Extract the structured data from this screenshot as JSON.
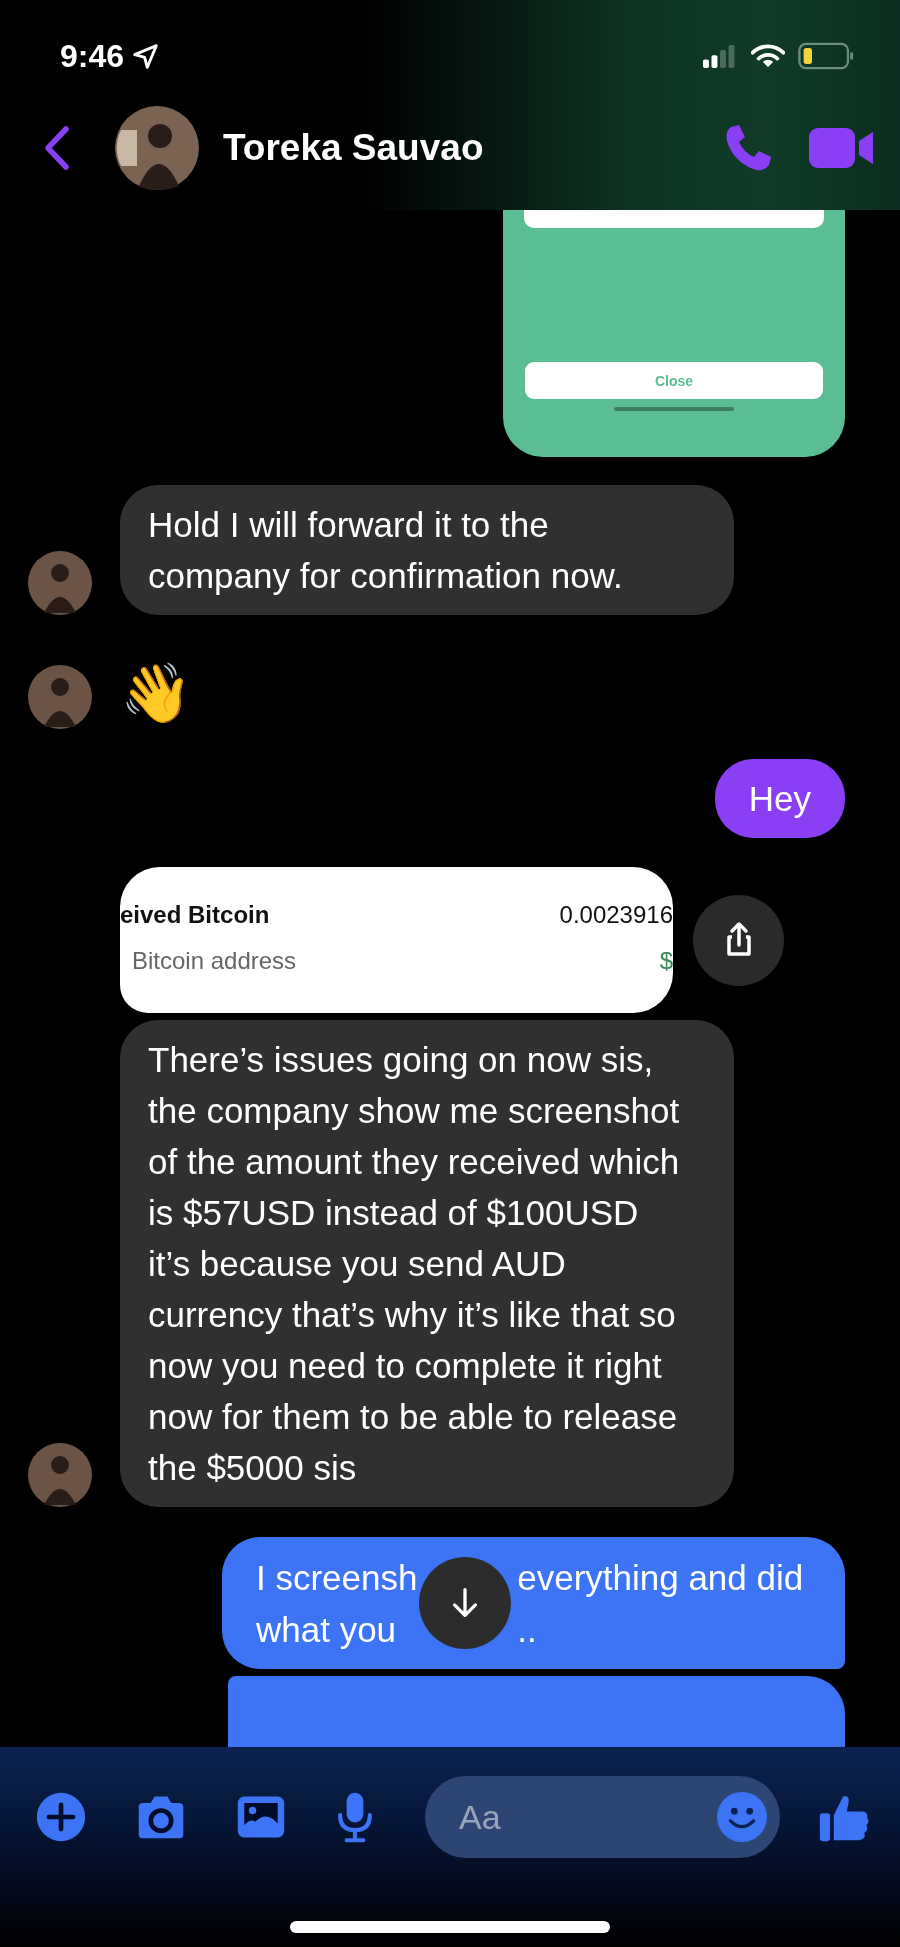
{
  "status_bar": {
    "time": "9:46"
  },
  "header": {
    "contact_name": "Toreka Sauvao"
  },
  "messages": [
    {
      "kind": "green_screenshot",
      "outgoing": true,
      "button": "Close"
    },
    {
      "kind": "text",
      "outgoing": false,
      "avatar": true,
      "text": "Hold I will forward it to the company for confirmation now."
    },
    {
      "kind": "emoji",
      "outgoing": false,
      "avatar": true,
      "text": "👋"
    },
    {
      "kind": "text",
      "outgoing": true,
      "color": "#8b3ff4",
      "text": "Hey"
    },
    {
      "kind": "receipt",
      "outgoing": false,
      "title": "eived Bitcoin",
      "subtitle": "Bitcoin address",
      "amount": "0.0023916",
      "fiat": "$"
    },
    {
      "kind": "text",
      "outgoing": false,
      "avatar": true,
      "text": "There’s issues going on now sis, the company show me screenshot of the amount they received which is $57USD instead of $100USD it’s because you send AUD currency that’s why it’s like that so now you need to complete it right now for them to be able to release the $5000 sis"
    },
    {
      "kind": "covered",
      "outgoing": true,
      "color": "#3d74f5",
      "left": [
        "I screensh",
        "what you"
      ],
      "right": [
        "everything and did",
        ".."
      ]
    },
    {
      "kind": "hidden",
      "outgoing": true,
      "color": "#3d74f5"
    }
  ],
  "composer": {
    "placeholder": "Aa"
  }
}
